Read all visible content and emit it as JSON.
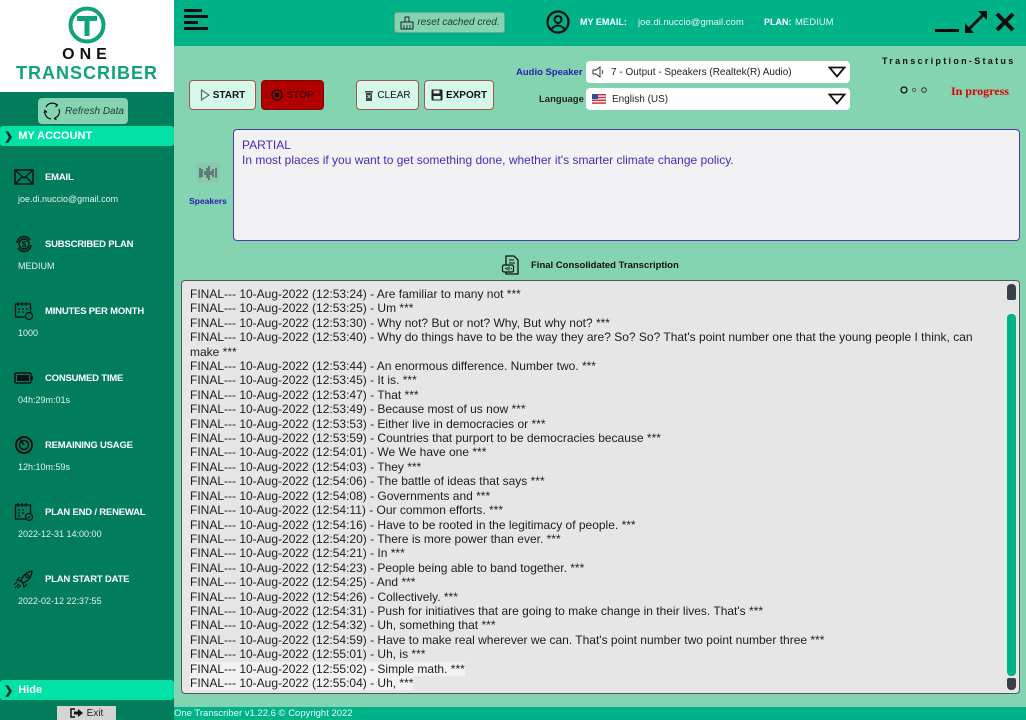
{
  "app": {
    "logo_line1": "ONE",
    "logo_line2": "TRANSCRIBER",
    "footer": "One Transcriber v1.22.6 © Copyright 2022"
  },
  "colors": {
    "primary": "#00b287",
    "sidebar": "#017d5c",
    "accent": "#02e2a6",
    "stop": "#b10000",
    "status_in_progress": "#e00000"
  },
  "sidebar": {
    "refresh_label": "Refresh Data",
    "section_title": "MY ACCOUNT",
    "items": [
      {
        "icon": "envelope-icon",
        "title": "EMAIL",
        "value": "joe.di.nuccio@gmail.com"
      },
      {
        "icon": "dollar-cycle-icon",
        "title": "SUBSCRIBED PLAN",
        "value": "MEDIUM"
      },
      {
        "icon": "calendar-clock-icon",
        "title": "MINUTES PER MONTH",
        "value": "1000"
      },
      {
        "icon": "battery-icon",
        "title": "CONSUMED TIME",
        "value": "04h:29m:01s"
      },
      {
        "icon": "timer-icon",
        "title": "REMAINING USAGE",
        "value": "12h:10m:59s"
      },
      {
        "icon": "calendar-check-icon",
        "title": "PLAN END / RENEWAL",
        "value": "2022-12-31 14:00:00"
      },
      {
        "icon": "rocket-icon",
        "title": "PLAN START DATE",
        "value": "2022-02-12 22:37:55"
      }
    ],
    "hide_label": "Hide",
    "exit_label": "Exit"
  },
  "header": {
    "reset_label": "reset cached cred.",
    "email_label": "MY EMAIL:",
    "email_value": "joe.di.nuccio@gmail.com",
    "plan_label": "PLAN:",
    "plan_value": "MEDIUM"
  },
  "controls": {
    "start": "START",
    "stop": "STOP",
    "clear": "CLEAR",
    "export": "EXPORT",
    "audio_speaker_label": "Audio Speaker",
    "audio_speaker_value": "7 - Output - Speakers (Realtek(R) Audio)",
    "language_label": "Language",
    "language_value": "English (US)"
  },
  "status": {
    "title": "Transcription-Status",
    "value": "In progress"
  },
  "partial": {
    "speakers_label": "Speakers",
    "heading": "PARTIAL",
    "text": "In most places if you want to get something done, whether it's smarter climate change policy."
  },
  "final": {
    "title": "Final Consolidated Transcription",
    "lines": [
      "FINAL--- 10-Aug-2022 (12:53:24) - Are familiar to many not ***",
      "FINAL--- 10-Aug-2022 (12:53:25) - Um ***",
      "FINAL--- 10-Aug-2022 (12:53:30) - Why not? But or not? Why, But why not? ***",
      "FINAL--- 10-Aug-2022 (12:53:40) - Why do things have to be the way they are? So? So? That's point number one that the young people I think, can make ***",
      "FINAL--- 10-Aug-2022 (12:53:44) - An enormous difference. Number two. ***",
      "FINAL--- 10-Aug-2022 (12:53:45) - It is. ***",
      "FINAL--- 10-Aug-2022 (12:53:47) - That ***",
      "FINAL--- 10-Aug-2022 (12:53:49) - Because most of us now ***",
      "FINAL--- 10-Aug-2022 (12:53:53) - Either live in democracies or ***",
      "FINAL--- 10-Aug-2022 (12:53:59) - Countries that purport to be democracies because ***",
      "FINAL--- 10-Aug-2022 (12:54:01) - We We have one ***",
      "FINAL--- 10-Aug-2022 (12:54:03) - They ***",
      "FINAL--- 10-Aug-2022 (12:54:06) - The battle of ideas that says ***",
      "FINAL--- 10-Aug-2022 (12:54:08) - Governments and ***",
      "FINAL--- 10-Aug-2022 (12:54:11) - Our common efforts. ***",
      "FINAL--- 10-Aug-2022 (12:54:16) - Have to be rooted in the legitimacy of people. ***",
      "FINAL--- 10-Aug-2022 (12:54:20) - There is more power than ever. ***",
      "FINAL--- 10-Aug-2022 (12:54:21) - In ***",
      "FINAL--- 10-Aug-2022 (12:54:23) - People being able to band together. ***",
      "FINAL--- 10-Aug-2022 (12:54:25) - And ***",
      "FINAL--- 10-Aug-2022 (12:54:26) - Collectively. ***",
      "FINAL--- 10-Aug-2022 (12:54:31) - Push for initiatives that are going to make change in their lives. That's ***",
      "FINAL--- 10-Aug-2022 (12:54:32) - Uh, something that ***",
      "FINAL--- 10-Aug-2022 (12:54:59) - Have to make real wherever we can. That's point number two point number three ***",
      "FINAL--- 10-Aug-2022 (12:55:01) - Uh, is ***",
      "FINAL--- 10-Aug-2022 (12:55:02) - Simple math. ***",
      "FINAL--- 10-Aug-2022 (12:55:04) - Uh, ***"
    ]
  }
}
